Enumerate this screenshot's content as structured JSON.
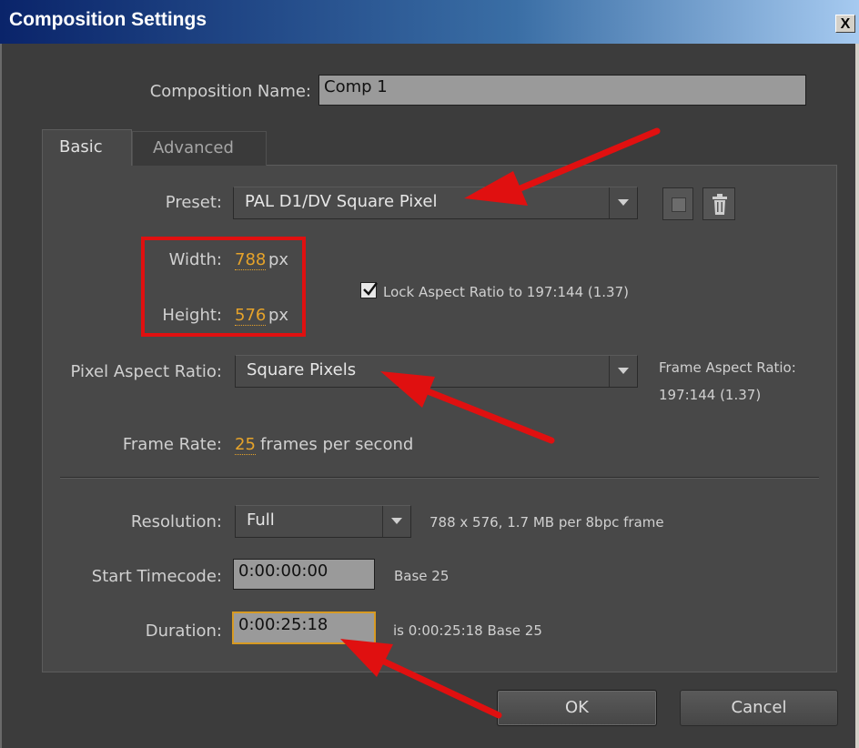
{
  "window": {
    "title": "Composition Settings",
    "close_glyph": "X"
  },
  "name_field": {
    "label": "Composition Name:",
    "value": "Comp 1"
  },
  "tabs": [
    {
      "label": "Basic",
      "active": true
    },
    {
      "label": "Advanced",
      "active": false
    }
  ],
  "preset": {
    "label": "Preset:",
    "value": "PAL D1/DV Square Pixel"
  },
  "width": {
    "label": "Width:",
    "value": "788",
    "unit": "px"
  },
  "height": {
    "label": "Height:",
    "value": "576",
    "unit": "px"
  },
  "lock_aspect": {
    "label": "Lock Aspect Ratio to 197:144 (1.37)",
    "checked": true
  },
  "pixel_aspect": {
    "label": "Pixel Aspect Ratio:",
    "value": "Square Pixels"
  },
  "frame_aspect": {
    "label": "Frame Aspect Ratio:",
    "value": "197:144 (1.37)"
  },
  "frame_rate": {
    "label": "Frame Rate:",
    "value": "25",
    "unit": "frames per second"
  },
  "resolution": {
    "label": "Resolution:",
    "value": "Full",
    "info": "788 x 576, 1.7 MB per 8bpc frame"
  },
  "start_timecode": {
    "label": "Start Timecode:",
    "value": "0:00:00:00",
    "info": "Base 25"
  },
  "duration": {
    "label": "Duration:",
    "value": "0:00:25:18",
    "info": "is 0:00:25:18  Base 25"
  },
  "buttons": {
    "ok": "OK",
    "cancel": "Cancel"
  },
  "icons": {
    "preset_save": "save-preset-icon",
    "preset_delete": "trash-icon",
    "checkmark": "checkmark-icon",
    "dropdown": "chevron-down-icon"
  },
  "colors": {
    "title_bar_start": "#0a246a",
    "title_bar_end": "#a6caf0",
    "value_highlight": "#e6a32a",
    "annotation_red": "#e01010",
    "panel_bg": "#484848"
  }
}
